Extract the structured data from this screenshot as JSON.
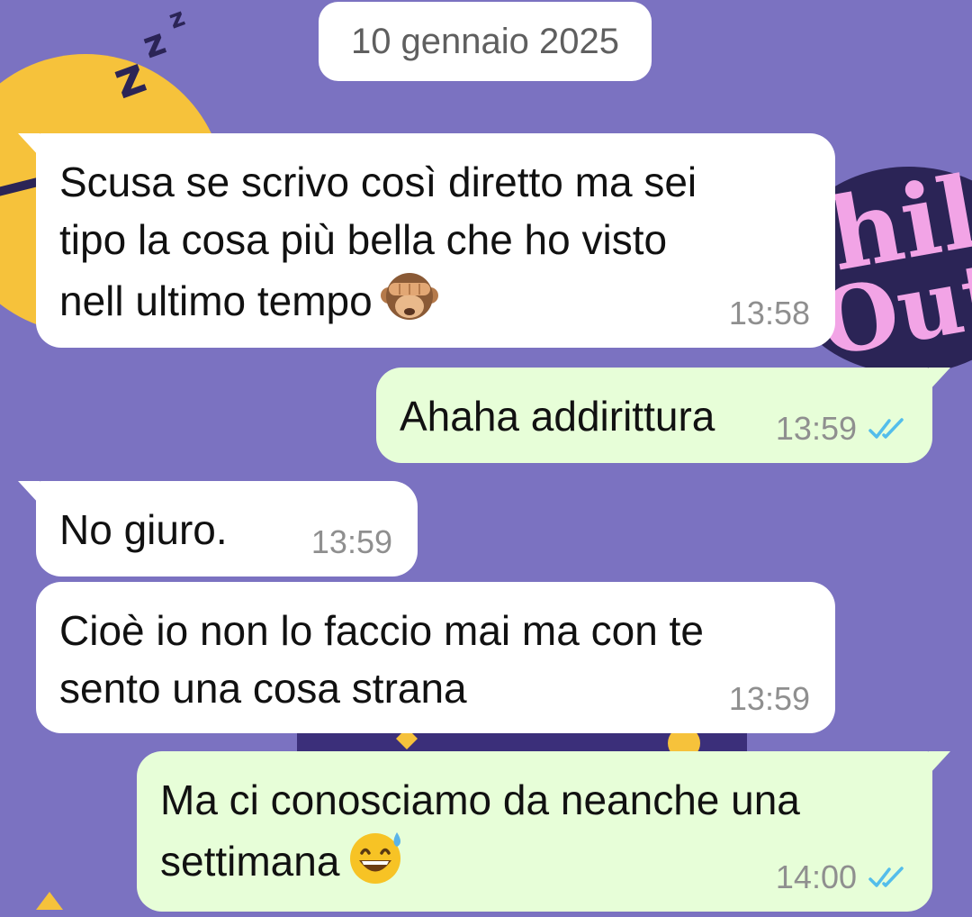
{
  "chat": {
    "date_separator": "10 gennaio 2025",
    "messages": [
      {
        "direction": "incoming",
        "text": "Scusa se scrivo così diretto ma sei\ntipo la cosa più bella che ho visto\nnell ultimo tempo",
        "emoji": "see-no-evil-monkey",
        "time": "13:58"
      },
      {
        "direction": "outgoing",
        "text": "Ahaha addirittura",
        "time": "13:59",
        "status": "read"
      },
      {
        "direction": "incoming",
        "text": "No giuro.",
        "time": "13:59"
      },
      {
        "direction": "incoming",
        "text": "Cioè io non lo faccio mai ma con te\nsento una cosa strana",
        "time": "13:59"
      },
      {
        "direction": "outgoing",
        "text": "Ma ci conosciamo da neanche una\nsettimana",
        "emoji": "grinning-face-with-sweat",
        "time": "14:00",
        "status": "read"
      }
    ]
  },
  "colors": {
    "wallpaper": "#7b72c1",
    "incoming_bubble": "#ffffff",
    "outgoing_bubble": "#e7fed8",
    "read_ticks": "#53bdeb",
    "timestamp": "#8f8f8f"
  }
}
